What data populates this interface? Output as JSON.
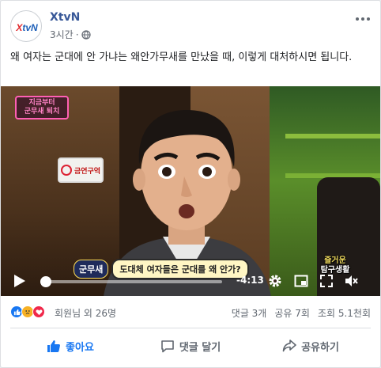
{
  "post": {
    "page_name": "XtvN",
    "logo_text": "XtvN",
    "time": "3시간",
    "separator": "·",
    "privacy_icon": "globe-icon",
    "caption": "왜 여자는 군대에 안 가냐는 왜안가무새를 만났을 때, 이렇게 대처하시면 됩니다."
  },
  "video": {
    "badge_line1": "지금부터",
    "badge_line2": "군무새 퇴치",
    "sign_text": "금연구역",
    "subtitle_tag": "군무새",
    "subtitle_text": "도대체 여자들은 군대를 왜 안가?",
    "corner_logo_line1": "즐거운",
    "corner_logo_line2": "탐구생활",
    "remaining_time": "-4:13",
    "progress_percent": 3,
    "controls": [
      "play-icon",
      "settings-icon",
      "miniplayer-icon",
      "fullscreen-icon",
      "volume-icon"
    ]
  },
  "stats": {
    "reactions": [
      "like",
      "sad",
      "love"
    ],
    "reaction_text": "회원님 외 26명",
    "comments": "댓글 3개",
    "shares": "공유 7회",
    "views": "조회 5.1천회"
  },
  "actions": {
    "like_label": "좋아요",
    "comment_label": "댓글 달기",
    "share_label": "공유하기"
  },
  "colors": {
    "link_blue": "#385898",
    "like_blue": "#1877f2",
    "logo_red": "#e0262a",
    "logo_blue": "#1d5fb8"
  }
}
